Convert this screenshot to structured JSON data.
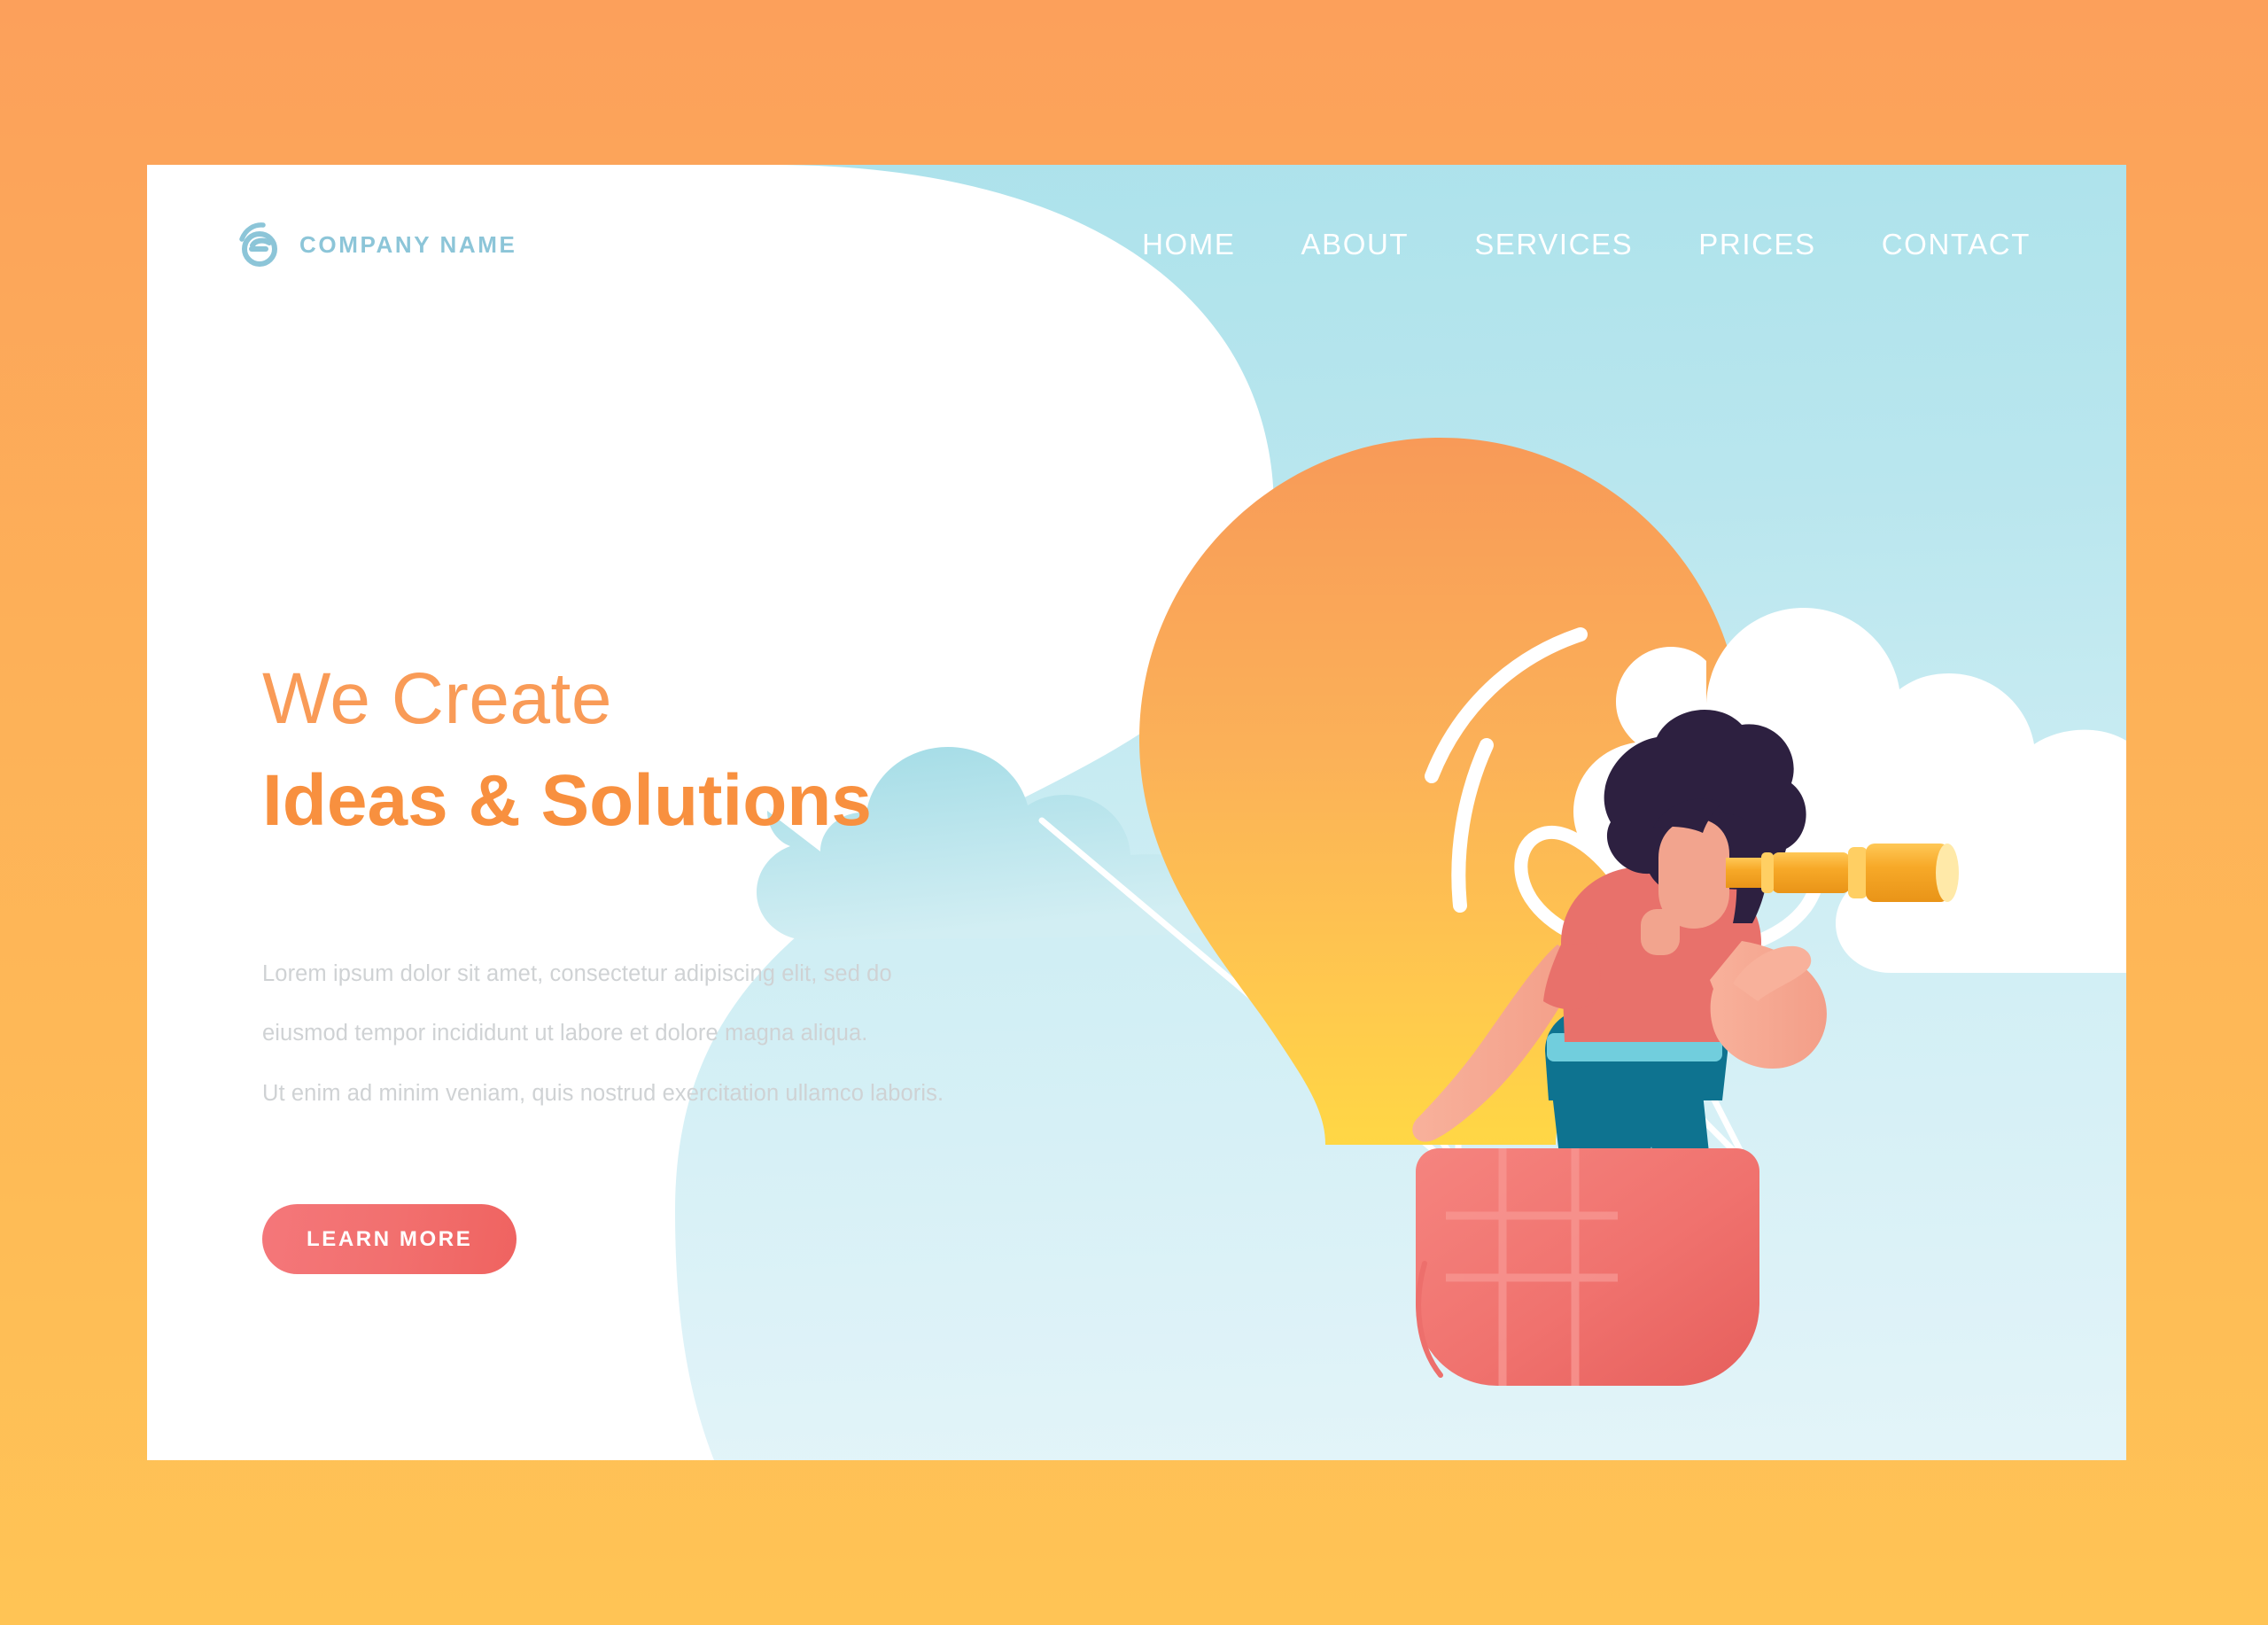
{
  "page": {
    "background_top_color": "#FCA05B",
    "background_bottom_color": "#FFC455",
    "card_background_color": "#FFFFFF",
    "sky_top_color": "#ACE2EB",
    "sky_bottom_color": "#E3F4F9"
  },
  "header": {
    "logo": {
      "icon": "swoosh-circle-e-logo",
      "color": "#8CC5D8",
      "company_name": "COMPANY NAME"
    },
    "nav": [
      {
        "label": "HOME"
      },
      {
        "label": "ABOUT"
      },
      {
        "label": "SERVICES"
      },
      {
        "label": "PRICES"
      },
      {
        "label": "CONTACT"
      }
    ],
    "nav_color": "#FFFFFF"
  },
  "hero": {
    "headline_line1": "We Create",
    "headline_line2": "Ideas & Solutions",
    "headline_color": "#F8903F",
    "paragraph_line1": "Lorem ipsum dolor sit amet, consectetur adipiscing elit, sed do",
    "paragraph_line2": "eiusmod tempor incididunt ut labore et dolore magna aliqua.",
    "paragraph_line3": "Ut enim ad minim veniam, quis nostrud exercitation ullamco laboris.",
    "paragraph_color": "#CFD2D4",
    "cta_label": "LEARN MORE",
    "cta_color": "#F2706F"
  },
  "illustration": {
    "name": "woman-with-telescope-in-lightbulb-hot-air-balloon",
    "balloon": {
      "shape": "lightbulb",
      "gradient_top_color": "#F9A05B",
      "gradient_bottom_color": "#FFD449",
      "filament_color": "#FFFFFF",
      "highlight_color": "#FFFFFF"
    },
    "basket": {
      "color_left": "#F4817D",
      "color_right": "#E85F5C",
      "grid_line_color": "#F6938F"
    },
    "character": {
      "hair_color": "#2D2040",
      "skin_color": "#F5A68F",
      "shirt_color": "#E8716B",
      "belt_color": "#71CEDD",
      "pants_color": "#0E7390",
      "telescope_color": "#F5A623",
      "telescope_highlight": "#FFD166"
    },
    "clouds": [
      {
        "name": "cloud-left-teal",
        "color": "#A9DDE6"
      },
      {
        "name": "cloud-center-white",
        "color": "#FFFFFF"
      },
      {
        "name": "cloud-right-white",
        "color": "#FFFFFF"
      }
    ],
    "rope_color": "#FFFFFF"
  }
}
